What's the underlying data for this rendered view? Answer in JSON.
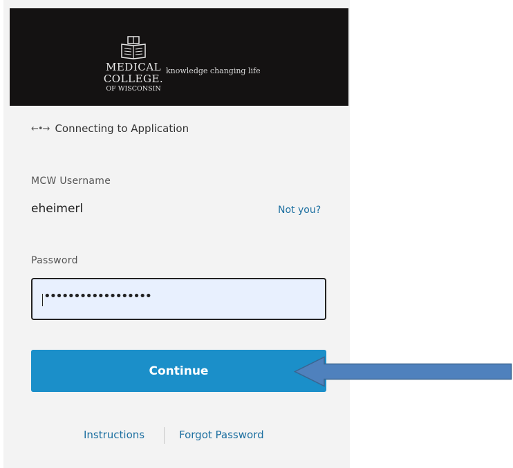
{
  "header": {
    "logo_line1": "MEDICAL",
    "logo_line2": "COLLEGE.",
    "logo_line3": "OF WISCONSIN",
    "tagline": "knowledge changing life"
  },
  "connecting": {
    "icon": "exchange-arrows-icon",
    "icon_glyph": "←•→",
    "label": "Connecting to Application"
  },
  "username": {
    "label": "MCW Username",
    "value": "eheimerl",
    "not_you": "Not you?"
  },
  "password": {
    "label": "Password",
    "masked_value": "••••••••••••••••••"
  },
  "continue_label": "Continue",
  "footer": {
    "instructions": "Instructions",
    "forgot_password": "Forgot Password"
  },
  "colors": {
    "accent": "#1b8fc9",
    "link": "#1c6fa0",
    "header_bg": "#141212",
    "annotation_arrow": "#4f81bd"
  }
}
